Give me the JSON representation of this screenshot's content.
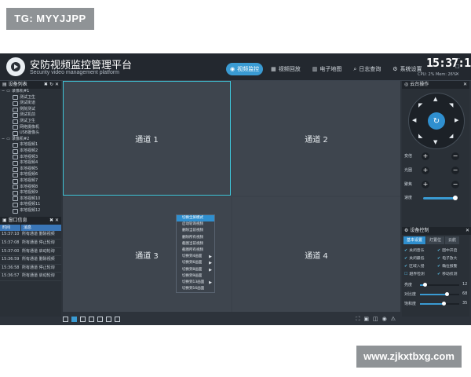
{
  "watermarks": {
    "top_left": "TG: MYYJJPP",
    "bottom_right": "www.zjkxtbxg.com"
  },
  "app": {
    "title": "安防视频监控管理平台",
    "subtitle": "Security video management platform",
    "clock": "15:37:16",
    "sysinfo": "CPU: 2%  Mem: 26%"
  },
  "nav": [
    {
      "label": "视频监控",
      "icon": "camera-icon",
      "active": true
    },
    {
      "label": "视频回放",
      "icon": "film-icon",
      "active": false
    },
    {
      "label": "电子地图",
      "icon": "map-icon",
      "active": false
    },
    {
      "label": "日志查询",
      "icon": "search-icon",
      "active": false
    },
    {
      "label": "系统设置",
      "icon": "gear-icon",
      "active": false
    }
  ],
  "device_list": {
    "header": "设备列表",
    "groups": [
      {
        "label": "录像机#1",
        "items": [
          "测试卫生",
          "测试街道",
          "侧院测试",
          "测试机前",
          "测试卫生",
          "网络摄像机",
          "USB摄像头"
        ]
      },
      {
        "label": "录像机#2",
        "items": [
          "本地视频1",
          "本地视频2",
          "本地视频3",
          "本地视频4",
          "本地视频5",
          "本地视频6",
          "本地视频7",
          "本地视频8",
          "本地视频9",
          "本地视频10",
          "本地视频11",
          "本地视频12"
        ]
      }
    ]
  },
  "window_info": {
    "header": "窗口信息",
    "columns": [
      "时间",
      "消息"
    ],
    "rows": [
      {
        "time": "15:37:10",
        "msg": "所有通道 删除视频"
      },
      {
        "time": "15:37:08",
        "msg": "所有通道 停止轮询"
      },
      {
        "time": "15:37:00",
        "msg": "所有通道 启动轮询"
      },
      {
        "time": "15:36:59",
        "msg": "所有通道 删除视频"
      },
      {
        "time": "15:36:58",
        "msg": "所有通道 停止轮询"
      },
      {
        "time": "15:36:57",
        "msg": "所有通道 启动轮询"
      }
    ]
  },
  "channels": [
    "通道 1",
    "通道 2",
    "通道 3",
    "通道 4"
  ],
  "context_menu": [
    {
      "label": "切换全屏模式",
      "highlight": true,
      "submenu": false
    },
    {
      "label": "启动轮询视频",
      "highlight": false,
      "submenu": false
    },
    {
      "label": "删除当前视频",
      "highlight": false,
      "submenu": false
    },
    {
      "label": "删除所有视频",
      "highlight": false,
      "submenu": false
    },
    {
      "label": "截图当前视频",
      "highlight": false,
      "submenu": false
    },
    {
      "label": "截图所有视频",
      "highlight": false,
      "submenu": false
    },
    {
      "label": "切换到4画面",
      "highlight": false,
      "submenu": true
    },
    {
      "label": "切换到6画面",
      "highlight": false,
      "submenu": true
    },
    {
      "label": "切换到8画面",
      "highlight": false,
      "submenu": true
    },
    {
      "label": "切换到9画面",
      "highlight": false,
      "submenu": false
    },
    {
      "label": "切换到13画面",
      "highlight": false,
      "submenu": true
    },
    {
      "label": "切换到16画面",
      "highlight": false,
      "submenu": false
    }
  ],
  "ptz": {
    "header": "云台操作",
    "controls": [
      "变倍",
      "光圈",
      "聚焦"
    ],
    "speed_label": "速度",
    "speed_level": 0.9
  },
  "device_control": {
    "header": "设备控制",
    "tabs": [
      "基本设置",
      "灯置位",
      "云航"
    ],
    "checks": [
      {
        "label": "关闭音乐",
        "checked": true
      },
      {
        "label": "图中开启",
        "checked": true
      },
      {
        "label": "关闭最低",
        "checked": true
      },
      {
        "label": "电子放大",
        "checked": true
      },
      {
        "label": "区域入侵",
        "checked": true
      },
      {
        "label": "确位报警",
        "checked": true
      },
      {
        "label": "越界检测",
        "checked": false
      },
      {
        "label": "移动侦测",
        "checked": true
      }
    ],
    "sliders": [
      {
        "label": "亮度",
        "value": 12,
        "level": 0.12
      },
      {
        "label": "对比度",
        "value": 68,
        "level": 0.68
      },
      {
        "label": "饱和度",
        "value": 35,
        "level": 0.6
      }
    ]
  }
}
